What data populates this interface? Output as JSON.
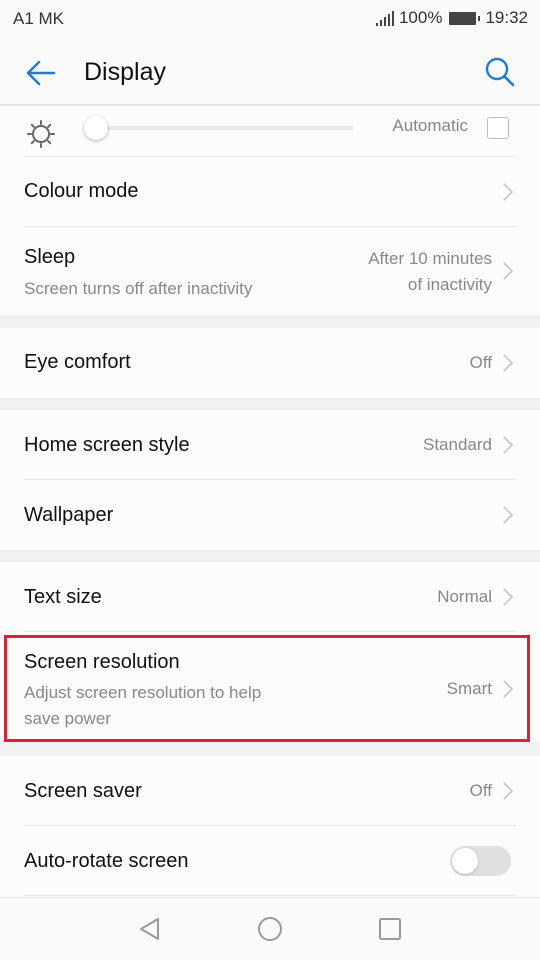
{
  "status_bar": {
    "carrier": "A1 MK",
    "battery_percent": "100%",
    "time": "19:32",
    "signal_icon": "signal-bars-icon",
    "battery_icon": "battery-full-icon"
  },
  "app_bar": {
    "title": "Display",
    "back_icon": "arrow-left-icon",
    "search_icon": "search-icon",
    "accent_color": "#1e7bd0"
  },
  "brightness": {
    "icon": "sun-icon",
    "level_fraction": 0.02,
    "automatic_label": "Automatic",
    "automatic_checked": false
  },
  "settings": {
    "colour_mode": {
      "title": "Colour mode"
    },
    "sleep": {
      "title": "Sleep",
      "subtitle": "Screen turns off after inactivity",
      "value_line1": "After 10 minutes",
      "value_line2": "of inactivity"
    },
    "eye_comfort": {
      "title": "Eye comfort",
      "value": "Off"
    },
    "home_screen_style": {
      "title": "Home screen style",
      "value": "Standard"
    },
    "wallpaper": {
      "title": "Wallpaper"
    },
    "text_size": {
      "title": "Text size",
      "value": "Normal"
    },
    "screen_resolution": {
      "title": "Screen resolution",
      "subtitle_line1": "Adjust screen resolution to help",
      "subtitle_line2": "save power",
      "value": "Smart",
      "highlighted": true
    },
    "screen_saver": {
      "title": "Screen saver",
      "value": "Off"
    },
    "auto_rotate": {
      "title": "Auto-rotate screen",
      "enabled": false
    }
  },
  "highlight_color": "#d9232e",
  "nav_bar": {
    "back_icon": "nav-back-triangle-icon",
    "home_icon": "nav-home-circle-icon",
    "recents_icon": "nav-recents-square-icon"
  }
}
